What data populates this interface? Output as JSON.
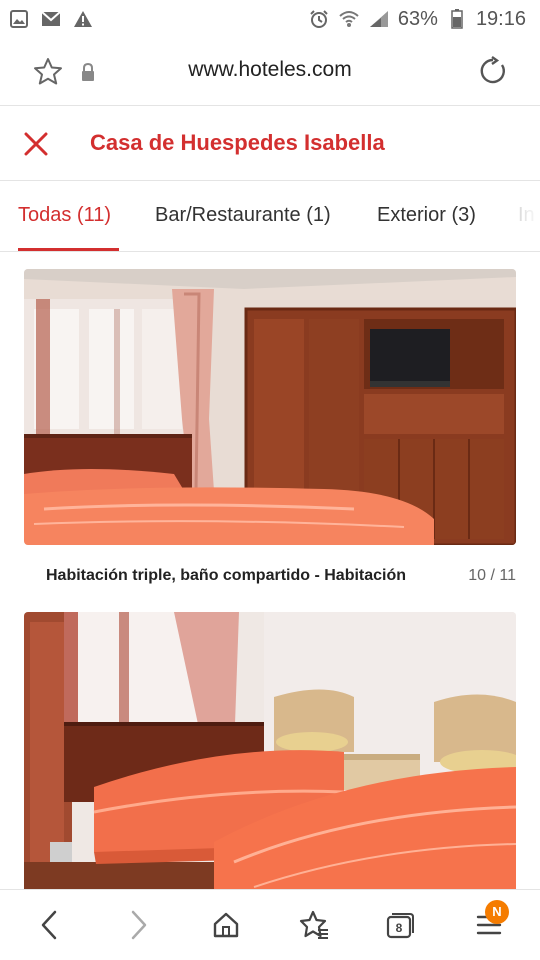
{
  "status_bar": {
    "battery": "63%",
    "time": "19:16",
    "icons": [
      "image-icon",
      "mail-icon",
      "warning-icon",
      "alarm-icon",
      "wifi-icon",
      "signal-icon",
      "battery-icon"
    ]
  },
  "browser": {
    "url": "www.hoteles.com",
    "icons": [
      "star-icon",
      "lock-icon",
      "reload-icon"
    ]
  },
  "header": {
    "title": "Casa de Huespedes Isabella",
    "close_icon": "close-icon"
  },
  "tabs": [
    {
      "label": "Todas (11)",
      "active": true
    },
    {
      "label": "Bar/Restaurante (1)",
      "active": false
    },
    {
      "label": "Exterior (3)",
      "active": false
    },
    {
      "label": "In",
      "active": false
    }
  ],
  "gallery": {
    "photos": [
      {
        "description_icon": "bedroom-photo",
        "caption": "Habitación triple, baño compartido - Habitación",
        "counter": "10 / 11"
      },
      {
        "description_icon": "bedroom-photo"
      }
    ]
  },
  "bottom_nav": {
    "tab_count": "8",
    "notification_badge": "N",
    "icons": [
      "back-icon",
      "forward-icon",
      "home-icon",
      "bookmarks-icon",
      "tabs-icon",
      "menu-icon"
    ]
  },
  "colors": {
    "accent": "#d32f2f",
    "badge": "#f57c00"
  }
}
